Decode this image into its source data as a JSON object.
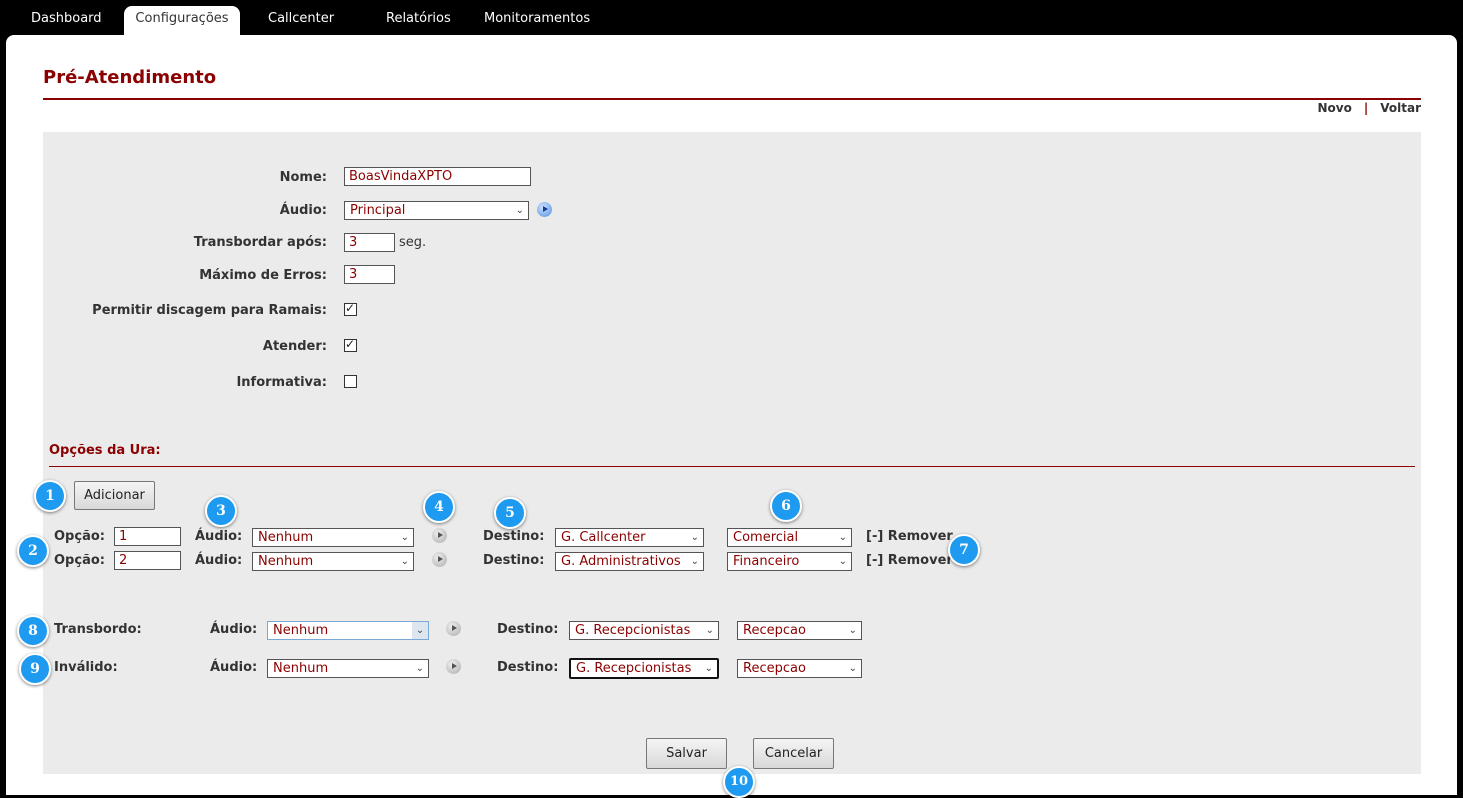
{
  "nav": {
    "tabs": [
      {
        "label": "Dashboard"
      },
      {
        "label": "Configurações"
      },
      {
        "label": "Callcenter"
      },
      {
        "label": "Relatórios"
      },
      {
        "label": "Monitoramentos"
      }
    ],
    "active_tab": "Configurações"
  },
  "page": {
    "title": "Pré-Atendimento",
    "links": {
      "novo": "Novo",
      "separator": "|",
      "voltar": "Voltar"
    }
  },
  "form": {
    "nome": {
      "label": "Nome:",
      "value": "BoasVindaXPTO"
    },
    "audio": {
      "label": "Áudio:",
      "value": "Principal"
    },
    "transbordar": {
      "label": "Transbordar após:",
      "value": "3",
      "unit": "seg."
    },
    "max_erros": {
      "label": "Máximo de Erros:",
      "value": "3"
    },
    "permitir_ramais": {
      "label": "Permitir discagem para Ramais:",
      "checked": true
    },
    "atender": {
      "label": "Atender:",
      "checked": true
    },
    "informativa": {
      "label": "Informativa:",
      "checked": false
    }
  },
  "ura": {
    "section_title": "Opções da Ura:",
    "add_button": "Adicionar",
    "options": [
      {
        "opcao_label": "Opção:",
        "opcao": "1",
        "audio_label": "Áudio:",
        "audio": "Nenhum",
        "destino_label": "Destino:",
        "destino": "G. Callcenter",
        "destino2": "Comercial",
        "remove": "[-] Remover"
      },
      {
        "opcao_label": "Opção:",
        "opcao": "2",
        "audio_label": "Áudio:",
        "audio": "Nenhum",
        "destino_label": "Destino:",
        "destino": "G. Administrativos",
        "destino2": "Financeiro",
        "remove": "[-] Remover"
      }
    ],
    "transbordo": {
      "label": "Transbordo:",
      "audio_label": "Áudio:",
      "audio": "Nenhum",
      "destino_label": "Destino:",
      "destino": "G. Recepcionistas",
      "destino2": "Recepcao"
    },
    "invalido": {
      "label": "Inválido:",
      "audio_label": "Áudio:",
      "audio": "Nenhum",
      "destino_label": "Destino:",
      "destino": "G. Recepcionistas",
      "destino2": "Recepcao"
    }
  },
  "actions": {
    "salvar": "Salvar",
    "cancelar": "Cancelar"
  },
  "badges": [
    "1",
    "2",
    "3",
    "4",
    "5",
    "6",
    "7",
    "8",
    "9",
    "10"
  ],
  "colors": {
    "accent": "#8b0000",
    "badge": "#1e9bf0",
    "panel": "#ebebeb"
  }
}
